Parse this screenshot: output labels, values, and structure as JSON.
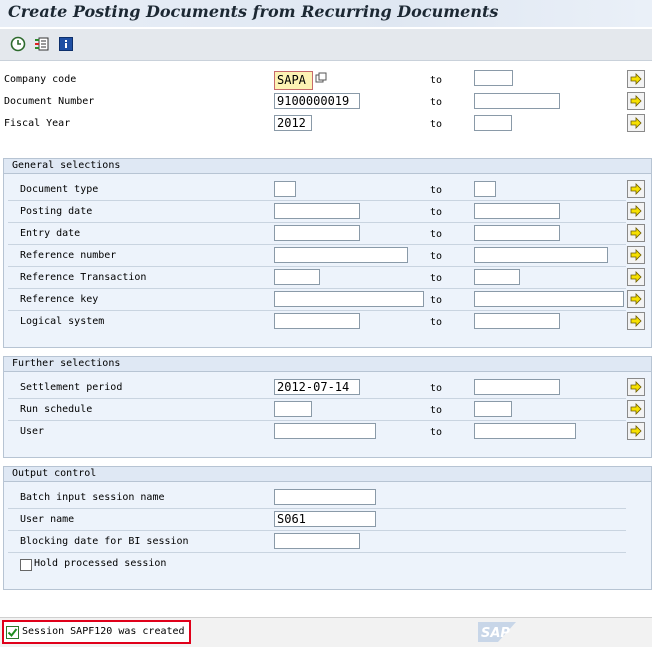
{
  "window": {
    "title": "Create Posting Documents from Recurring Documents"
  },
  "toolbar": {
    "execute_icon": "execute-clock-icon",
    "variant_icon": "variant-icon",
    "info_icon": "info-icon"
  },
  "main": {
    "to_label": "to",
    "company_code": {
      "label": "Company code",
      "value": "SAPA"
    },
    "document_number": {
      "label": "Document Number",
      "value": "9100000019"
    },
    "fiscal_year": {
      "label": "Fiscal Year",
      "value": "2012"
    }
  },
  "general": {
    "title": "General selections",
    "document_type": {
      "label": "Document type",
      "value": ""
    },
    "posting_date": {
      "label": "Posting date",
      "value": ""
    },
    "entry_date": {
      "label": "Entry date",
      "value": ""
    },
    "reference_number": {
      "label": "Reference number",
      "value": ""
    },
    "reference_transaction": {
      "label": "Reference Transaction",
      "value": ""
    },
    "reference_key": {
      "label": "Reference key",
      "value": ""
    },
    "logical_system": {
      "label": "Logical system",
      "value": ""
    }
  },
  "further": {
    "title": "Further selections",
    "settlement_period": {
      "label": "Settlement period",
      "value": "2012-07-14"
    },
    "run_schedule": {
      "label": "Run schedule",
      "value": ""
    },
    "user": {
      "label": "User",
      "value": ""
    }
  },
  "output": {
    "title": "Output control",
    "batch_session": {
      "label": "Batch input session name",
      "value": ""
    },
    "user_name": {
      "label": "User name",
      "value": "S061"
    },
    "blocking_date": {
      "label": "Blocking date for BI session",
      "value": ""
    },
    "hold_processed": {
      "label": "Hold processed session",
      "checked": false
    }
  },
  "statusbar": {
    "message": "Session SAPF120 was created",
    "logo": "SAP"
  },
  "colors": {
    "status_highlight": "#e0001a",
    "arrow_button": "#f6e000"
  }
}
